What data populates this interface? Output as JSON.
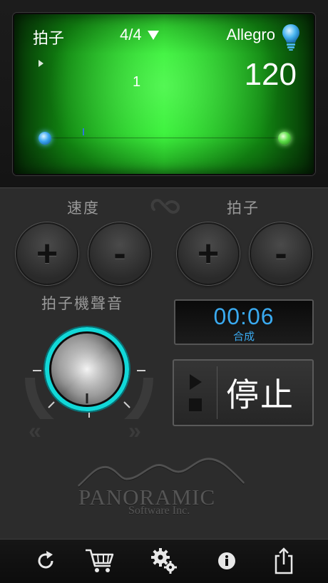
{
  "display": {
    "beats_label": "拍子",
    "time_signature": "4/4",
    "tempo_name": "Allegro",
    "beat_count": "1",
    "bpm": "120"
  },
  "controls": {
    "speed_label": "速度",
    "beats_label": "拍子",
    "plus": "+",
    "minus": "-",
    "sound_label": "拍子機聲音"
  },
  "timer": {
    "value": "00:06",
    "label": "合成"
  },
  "transport": {
    "stop_label": "停止"
  },
  "logo": {
    "name": "PANORAMIC",
    "sub": "Software Inc."
  },
  "colors": {
    "accent_blue": "#3aaaf0",
    "display_green": "#28ee28",
    "knob_ring": "#12d8d8"
  },
  "toolbar": {
    "icons": [
      "refresh-icon",
      "cart-icon",
      "settings-icon",
      "info-icon",
      "share-icon"
    ]
  }
}
